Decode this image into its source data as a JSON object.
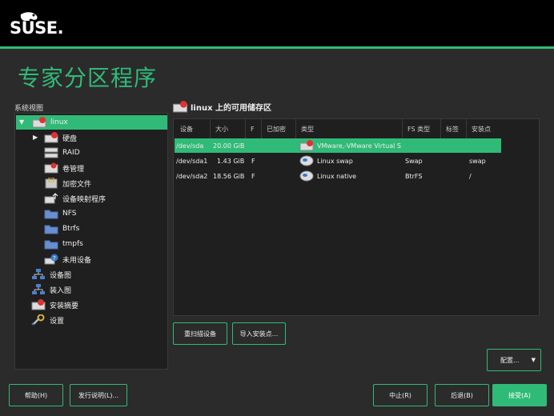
{
  "header": {
    "logo_text": "SUSE."
  },
  "page_title": "专家分区程序",
  "sidebar": {
    "label": "系统视图",
    "items": [
      {
        "label": "linux",
        "icon": "hard-disk-icon"
      },
      {
        "label": "硬盘",
        "icon": "hard-disk-icon"
      },
      {
        "label": "RAID",
        "icon": "raid-icon"
      },
      {
        "label": "卷管理",
        "icon": "volume-manager-icon"
      },
      {
        "label": "加密文件",
        "icon": "crypt-file-icon"
      },
      {
        "label": "设备映射程序",
        "icon": "device-mapper-icon"
      },
      {
        "label": "NFS",
        "icon": "folder-icon"
      },
      {
        "label": "Btrfs",
        "icon": "folder-icon"
      },
      {
        "label": "tmpfs",
        "icon": "folder-icon"
      },
      {
        "label": "未用设备",
        "icon": "unused-device-icon"
      },
      {
        "label": "设备图",
        "icon": "device-graph-icon"
      },
      {
        "label": "装入图",
        "icon": "mount-graph-icon"
      },
      {
        "label": "安装摘要",
        "icon": "install-summary-icon"
      },
      {
        "label": "设置",
        "icon": "settings-wrench-icon"
      }
    ]
  },
  "main": {
    "section_title": "linux 上的可用储存区",
    "columns": [
      "设备",
      "大小",
      "F",
      "已加密",
      "类型",
      "FS 类型",
      "标签",
      "安装点"
    ],
    "rows": [
      {
        "device": "/dev/sda",
        "size": "20.00 GiB",
        "f": "",
        "encrypted": "",
        "type": "VMware,-VMware Virtual S",
        "fs_type": "",
        "label": "",
        "mount": ""
      },
      {
        "device": "/dev/sda1",
        "size": "1.43 GiB",
        "f": "F",
        "encrypted": "",
        "type": "Linux swap",
        "fs_type": "Swap",
        "label": "",
        "mount": "swap"
      },
      {
        "device": "/dev/sda2",
        "size": "18.56 GiB",
        "f": "F",
        "encrypted": "",
        "type": "Linux native",
        "fs_type": "BtrFS",
        "label": "",
        "mount": "/"
      }
    ],
    "rescan_label": "重扫描设备",
    "import_label": "导入安装点...",
    "configure_label": "配置..."
  },
  "footer": {
    "help_label": "帮助(H)",
    "release_notes_label": "发行说明(L)...",
    "abort_label": "中止(R)",
    "back_label": "后退(B)",
    "accept_label": "接受(A)"
  },
  "colors": {
    "accent": "#30ba78",
    "background": "#2b2b2b",
    "panel": "#1f1f1f"
  }
}
